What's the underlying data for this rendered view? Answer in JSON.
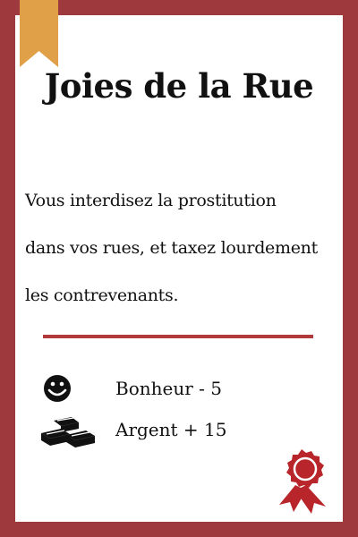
{
  "card": {
    "title": "Joies de la Rue",
    "description_lines": [
      "Vous interdisez la prostitution",
      "dans vos rues, et taxez lourdement",
      "les contrevenants."
    ]
  },
  "effects": [
    {
      "icon": "smiley-icon",
      "label": "Bonheur  -  5"
    },
    {
      "icon": "gold-bars-icon",
      "label": "Argent  +  15"
    }
  ],
  "colors": {
    "border": "#9e3a3d",
    "divider": "#b33a3c",
    "bookmark": "#e0a048",
    "seal": "#b8262b"
  }
}
